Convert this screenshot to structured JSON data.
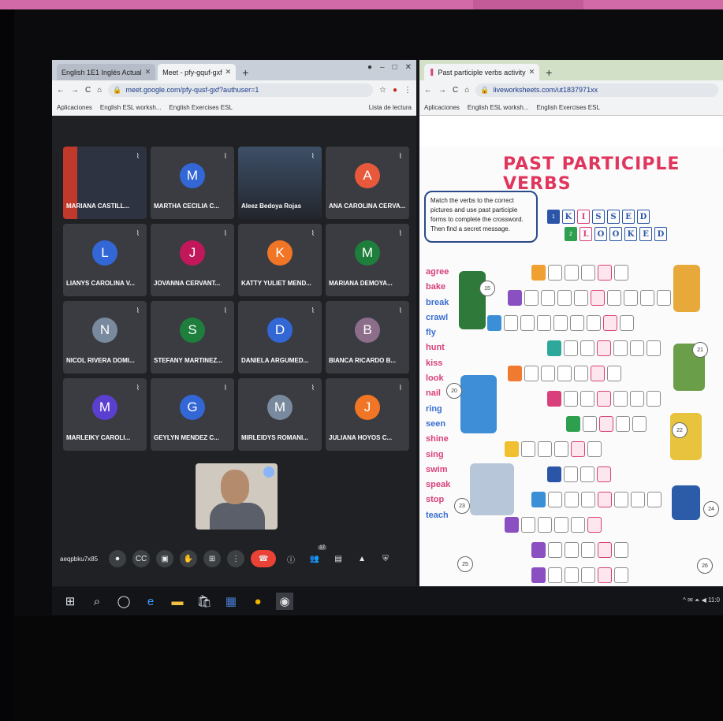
{
  "left_browser": {
    "tabs": [
      {
        "label": "English 1E1 Inglés Actual",
        "active": false
      },
      {
        "label": "Meet - pfy-gquf-gxf",
        "active": true
      }
    ],
    "window_controls": [
      "●",
      "–",
      "□",
      "✕"
    ],
    "nav": [
      "←",
      "→",
      "C",
      "⌂"
    ],
    "url": "meet.google.com/pfy-qusf-gxf?authuser=1",
    "bookmarks": [
      "Aplicaciones",
      "English ESL worksh...",
      "English Exercises ESL",
      "Lista de lectura"
    ]
  },
  "participants": [
    {
      "name": "MARIANA CASTILL...",
      "initial": "",
      "color": "#7a3a2a",
      "video": true
    },
    {
      "name": "MARTHA CECILIA C...",
      "initial": "M",
      "color": "#3367d6"
    },
    {
      "name": "Aleez Bedoya Rojas",
      "initial": "",
      "color": "#5f6368",
      "video": true
    },
    {
      "name": "ANA CAROLINA CERVA...",
      "initial": "A",
      "color": "#e8593c"
    },
    {
      "name": "LIANYS CAROLINA V...",
      "initial": "L",
      "color": "#3367d6"
    },
    {
      "name": "JOVANNA CERVANT...",
      "initial": "J",
      "color": "#c2185b"
    },
    {
      "name": "KATTY YULIET MEND...",
      "initial": "K",
      "color": "#f07524"
    },
    {
      "name": "MARIANA DEMOYA...",
      "initial": "M",
      "color": "#1e7f3c"
    },
    {
      "name": "NICOL RIVERA DOMI...",
      "initial": "N",
      "color": "#7a8a9e"
    },
    {
      "name": "STEFANY MARTINEZ...",
      "initial": "S",
      "color": "#1e7f3c"
    },
    {
      "name": "DANIELA ARGUMED...",
      "initial": "D",
      "color": "#3367d6"
    },
    {
      "name": "BIANCA RICARDO B...",
      "initial": "B",
      "color": "#8d6e8a"
    },
    {
      "name": "MARLEIKY CAROLI...",
      "initial": "M",
      "color": "#5b3fd1"
    },
    {
      "name": "GEYLYN MENDEZ C...",
      "initial": "G",
      "color": "#3367d6"
    },
    {
      "name": "MIRLEIDYS ROMANI...",
      "initial": "M",
      "color": "#7a8a9e"
    },
    {
      "name": "JULIANA HOYOS C...",
      "initial": "J",
      "color": "#f07524"
    }
  ],
  "controls": {
    "meeting_code": "aeqpbku7x85",
    "buttons": [
      "⏺",
      "CC",
      "▣",
      "✋",
      "⊞",
      "⋮",
      "☎",
      "ⓘ",
      "👥",
      "▤",
      "▲",
      "⛨"
    ],
    "badge": "17"
  },
  "right_browser": {
    "tab": "Past participle verbs activity",
    "nav": [
      "←",
      "→",
      "C",
      "⌂"
    ],
    "url": "liveworksheets.com/ut1837971xx",
    "bookmarks": [
      "Aplicaciones",
      "English ESL worksh...",
      "English Exercises ESL"
    ]
  },
  "worksheet": {
    "title": "PAST PARTICIPLE VERBS",
    "instructions": "Match the verbs to the correct pictures and use past participle forms to complete the crossword. Then find a secret message.",
    "example_rows": [
      {
        "num": "1",
        "letters": [
          "K",
          "I",
          "S",
          "S",
          "E",
          "D"
        ]
      },
      {
        "num": "2",
        "letters": [
          "L",
          "O",
          "O",
          "K",
          "E",
          "D"
        ]
      }
    ],
    "verbs": [
      "agree",
      "bake",
      "break",
      "crawl",
      "fly",
      "hunt",
      "kiss",
      "look",
      "nail",
      "ring",
      "seen",
      "shine",
      "sing",
      "swim",
      "speak",
      "stop",
      "teach"
    ],
    "verb_colors": [
      "#d9407b",
      "#d9407b",
      "#3a6fd1",
      "#3a6fd1",
      "#3a6fd1",
      "#d9407b",
      "#d9407b",
      "#d9407b",
      "#d9407b",
      "#3a6fd1",
      "#3a6fd1",
      "#d9407b",
      "#d9407b",
      "#d9407b",
      "#d9407b",
      "#d9407b",
      "#3a6fd1"
    ],
    "circle_labels": [
      "15",
      "20",
      "21",
      "22",
      "23",
      "24",
      "25",
      "26"
    ]
  },
  "taskbar": {
    "icons": [
      "⊞",
      "⌕",
      "◯",
      "e",
      "▬",
      "🛍",
      "▦",
      "●",
      "◉"
    ],
    "tray": "^ ✉ ⏶ ◀ 11:0"
  }
}
